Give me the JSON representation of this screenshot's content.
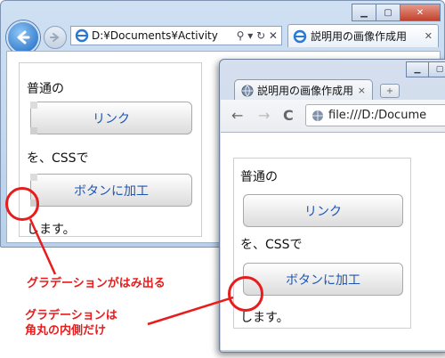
{
  "ie": {
    "address": "D:¥Documents¥Activity",
    "address_tools": "⚲ ▾ ↻ ✕",
    "tab_title": "説明用の画像作成用",
    "tab_close": "✕",
    "window_controls": [
      "▁",
      "▢",
      "✕"
    ]
  },
  "chrome": {
    "tab_title": "説明用の画像作成用",
    "tab_close": "×",
    "newtab": "+",
    "url": "file:///D:/Docume",
    "window_controls": [
      "▁",
      "▢"
    ],
    "nav": [
      "←",
      "→",
      "C"
    ]
  },
  "page": {
    "line1": "普通の",
    "link_label": "リンク",
    "line2": "を、CSSで",
    "button_label": "ボタンに加工",
    "line3": "します。"
  },
  "annotations": {
    "a1": "グラデーションがはみ出る",
    "a2_line1": "グラデーションは",
    "a2_line2": "角丸の内側だけ"
  },
  "colors": {
    "annotation": "#e81c1c",
    "link": "#1c56b5"
  }
}
